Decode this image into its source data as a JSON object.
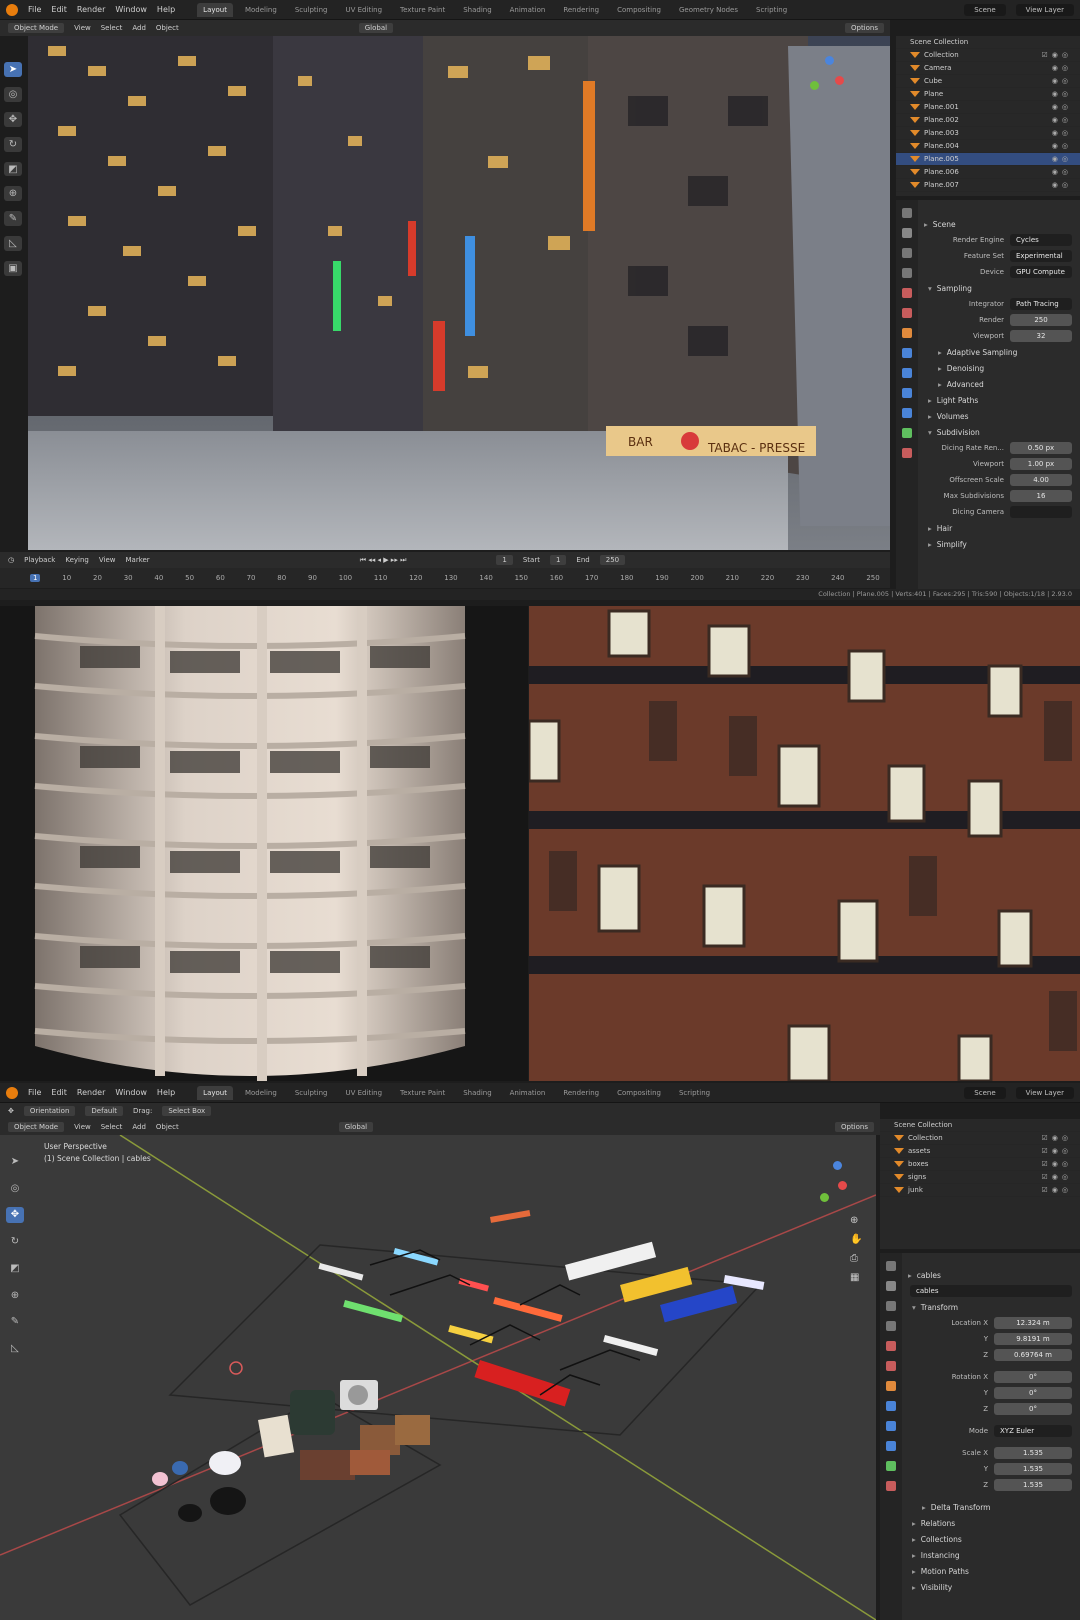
{
  "top_window": {
    "menu": [
      "File",
      "Edit",
      "Render",
      "Window",
      "Help"
    ],
    "workspaces": [
      "Layout",
      "Modeling",
      "Sculpting",
      "UV Editing",
      "Texture Paint",
      "Shading",
      "Animation",
      "Rendering",
      "Compositing",
      "Geometry Nodes",
      "Scripting"
    ],
    "active_workspace": "Layout",
    "scene": "Scene",
    "view_layer": "View Layer",
    "header": {
      "mode": "Object Mode",
      "view": "View",
      "select": "Select",
      "add": "Add",
      "object": "Object",
      "transform": "Global",
      "options": "Options"
    },
    "outliner": {
      "root": "Scene Collection",
      "items": [
        {
          "name": "Collection",
          "selected": false
        },
        {
          "name": "Camera",
          "selected": false
        },
        {
          "name": "Cube",
          "selected": false
        },
        {
          "name": "Plane",
          "selected": false
        },
        {
          "name": "Plane.001",
          "selected": false
        },
        {
          "name": "Plane.002",
          "selected": false
        },
        {
          "name": "Plane.003",
          "selected": false
        },
        {
          "name": "Plane.004",
          "selected": false
        },
        {
          "name": "Plane.005",
          "selected": true
        },
        {
          "name": "Plane.006",
          "selected": false
        },
        {
          "name": "Plane.007",
          "selected": false
        }
      ]
    },
    "properties": {
      "context": "Scene",
      "render_engine_label": "Render Engine",
      "render_engine": "Cycles",
      "feature_set_label": "Feature Set",
      "feature_set": "Experimental",
      "device_label": "Device",
      "device": "GPU Compute",
      "sampling": "Sampling",
      "integrator_label": "Integrator",
      "integrator": "Path Tracing",
      "render_label": "Render",
      "render_samples": "250",
      "viewport_label": "Viewport",
      "viewport_samples": "32",
      "adaptive": "Adaptive Sampling",
      "denoising": "Denoising",
      "advanced": "Advanced",
      "light_paths": "Light Paths",
      "volumes": "Volumes",
      "subdivision": "Subdivision",
      "dicing_render_label": "Dicing Rate Ren...",
      "dicing_render": "0.50 px",
      "dicing_viewport_label": "Viewport",
      "dicing_viewport": "1.00 px",
      "offscreen_label": "Offscreen Scale",
      "offscreen": "4.00",
      "max_subdiv_label": "Max Subdivisions",
      "max_subdiv": "16",
      "dicing_camera_label": "Dicing Camera",
      "hair": "Hair",
      "simplify": "Simplify"
    },
    "timeline": {
      "playback": "Playback",
      "keying": "Keying",
      "view": "View",
      "marker": "Marker",
      "current_frame": "1",
      "start_label": "Start",
      "start": "1",
      "end_label": "End",
      "end": "250",
      "ticks": [
        "1",
        "10",
        "20",
        "30",
        "40",
        "50",
        "60",
        "70",
        "80",
        "90",
        "100",
        "110",
        "120",
        "130",
        "140",
        "150",
        "160",
        "170",
        "180",
        "190",
        "200",
        "210",
        "220",
        "230",
        "240",
        "250"
      ]
    },
    "status": "Collection | Plane.005 | Verts:401 | Faces:295 | Tris:590 | Objects:1/18 | 2.93.0",
    "signs": {
      "bar": "BAR",
      "tabac": "TABAC - PRESSE"
    }
  },
  "bottom_window": {
    "menu": [
      "File",
      "Edit",
      "Render",
      "Window",
      "Help"
    ],
    "workspaces": [
      "Layout",
      "Modeling",
      "Sculpting",
      "UV Editing",
      "Texture Paint",
      "Shading",
      "Animation",
      "Rendering",
      "Compositing",
      "Scripting"
    ],
    "active_workspace": "Layout",
    "scene": "Scene",
    "view_layer": "View Layer",
    "tool_header": {
      "orientation": "Orientation",
      "default": "Default",
      "drag": "Drag:",
      "select_box": "Select Box"
    },
    "header": {
      "mode": "Object Mode",
      "view": "View",
      "select": "Select",
      "add": "Add",
      "object": "Object",
      "transform": "Global",
      "options": "Options"
    },
    "viewport_info": {
      "line1": "User Perspective",
      "line2": "(1) Scene Collection | cables"
    },
    "outliner": {
      "root": "Scene Collection",
      "items": [
        {
          "name": "Collection"
        },
        {
          "name": "assets"
        },
        {
          "name": "boxes"
        },
        {
          "name": "signs"
        },
        {
          "name": "junk"
        }
      ]
    },
    "properties": {
      "object_name": "cables",
      "object_field": "cables",
      "transform": "Transform",
      "location_label": "Location X",
      "location": [
        "12.324 m",
        "9.8191 m",
        "0.69764 m"
      ],
      "rotation_label": "Rotation X",
      "rotation": [
        "0°",
        "0°",
        "0°"
      ],
      "mode_label": "Mode",
      "mode": "XYZ Euler",
      "scale_label": "Scale X",
      "scale": [
        "1.535",
        "1.535",
        "1.535"
      ],
      "axis_y": "Y",
      "axis_z": "Z",
      "delta": "Delta Transform",
      "relations": "Relations",
      "collections": "Collections",
      "instancing": "Instancing",
      "motion_paths": "Motion Paths",
      "visibility": "Visibility"
    }
  },
  "colors": {
    "accent": "#4772b3",
    "orange": "#e87d0d",
    "selected_row": "#334d80"
  }
}
